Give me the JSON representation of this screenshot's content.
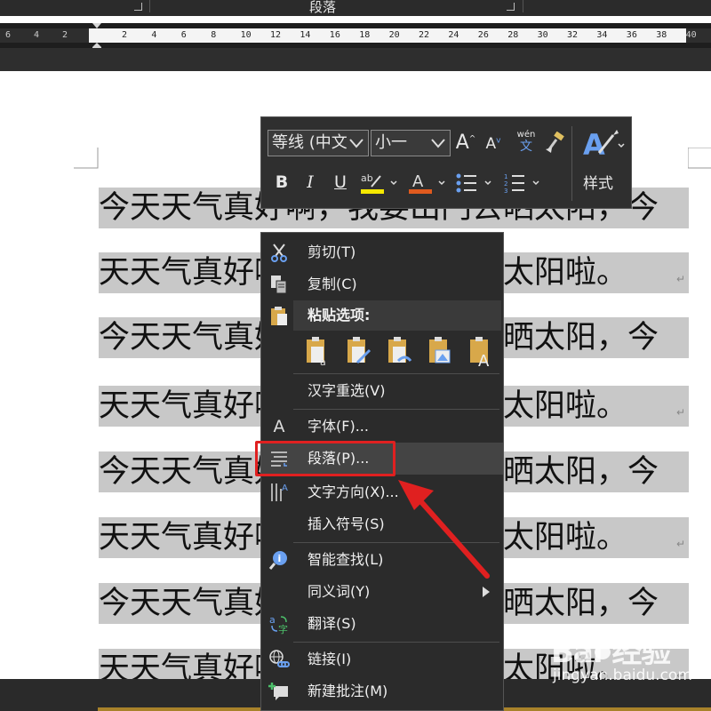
{
  "ribbon": {
    "group_label": "段落"
  },
  "ruler": {
    "left_numbers": [
      "6",
      "4",
      "2"
    ],
    "right_numbers": [
      "2",
      "4",
      "6",
      "8",
      "10",
      "12",
      "14",
      "16",
      "18",
      "20",
      "22",
      "24",
      "26",
      "28",
      "30",
      "32",
      "34",
      "36",
      "38",
      "40"
    ]
  },
  "document": {
    "lines": [
      "今天天气真好啊，我要出门去晒太阳，今",
      "天天气真好啊，我要出门去晒太阳啦。",
      "今天天气真好啊，我要出门去晒太阳，今",
      "天天气真好啊，我要出门去晒太阳啦。",
      "今天天气真好啊，我要出门去晒太阳，今",
      "天天气真好啊，我要出门去晒太阳啦。",
      "今天天气真好啊，我要出门去晒太阳，今",
      "天天气真好啊，我要出门去晒太阳啦。"
    ],
    "paragraph_mark": "↵"
  },
  "mini_toolbar": {
    "font_name": "等线 (中文",
    "font_size": "小一",
    "grow_font": "A",
    "shrink_font": "A",
    "phonetic_top": "wén",
    "phonetic_bottom": "文",
    "bold": "B",
    "italic": "I",
    "underline": "U",
    "font_color": "A",
    "styles_label": "样式",
    "highlight_color": "#f5e800",
    "font_color_bar": "#e05a1e"
  },
  "context_menu": {
    "cut": "剪切(T)",
    "copy": "复制(C)",
    "paste_options": "粘贴选项:",
    "reconvert": "汉字重选(V)",
    "font": "字体(F)...",
    "font_icon": "A",
    "paragraph": "段落(P)...",
    "text_direction": "文字方向(X)...",
    "insert_symbol": "插入符号(S)",
    "smart_lookup": "智能查找(L)",
    "synonyms": "同义词(Y)",
    "translate": "翻译(S)",
    "link": "链接(I)",
    "new_comment": "新建批注(M)"
  },
  "watermark": {
    "brand": "Bai 经验",
    "url": "jingyan.baidu.com"
  },
  "colors": {
    "highlight_box": "#e02020",
    "selection": "#c8c8c8",
    "menu_bg": "#2b2b2b"
  }
}
